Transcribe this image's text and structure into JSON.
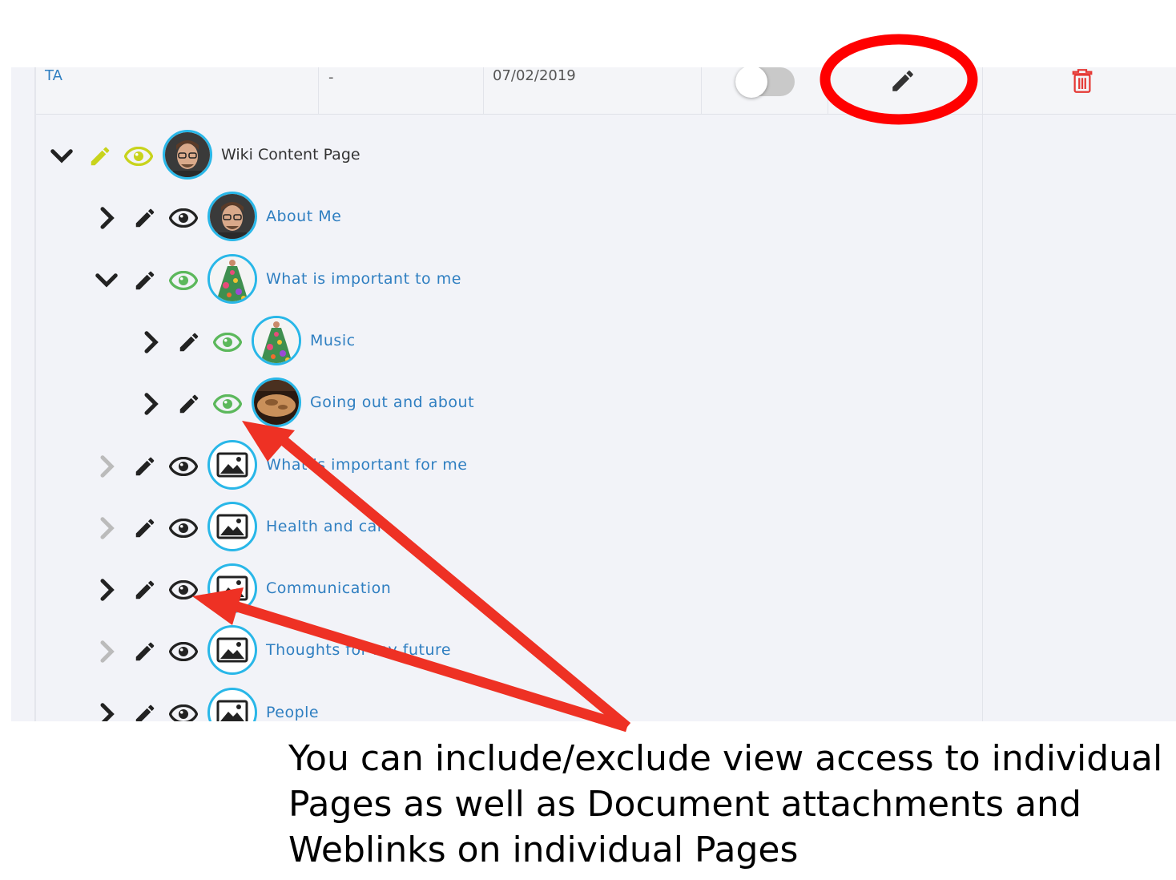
{
  "table_row": {
    "name": "TA",
    "dash": "-",
    "date": "07/02/2019",
    "toggle_state": "off"
  },
  "tree": {
    "root": {
      "label": "Wiki Content Page",
      "expanded": true,
      "edit_color": "#c8d31c",
      "view_color": "#c8d31c",
      "avatar": "man-with-glasses"
    },
    "items": [
      {
        "label": "About Me",
        "level": 1,
        "chevron": "right",
        "chevron_color": "#222222",
        "view_color": "#222222",
        "avatar": "man-with-glasses"
      },
      {
        "label": "What is important to me",
        "level": 1,
        "chevron": "down",
        "chevron_color": "#222222",
        "view_color": "#5cb85c",
        "avatar": "flower-dress"
      },
      {
        "label": "Music",
        "level": 2,
        "chevron": "right",
        "chevron_color": "#222222",
        "view_color": "#5cb85c",
        "avatar": "flower-dress"
      },
      {
        "label": "Going out and about",
        "level": 2,
        "chevron": "right",
        "chevron_color": "#222222",
        "view_color": "#5cb85c",
        "avatar": "bread"
      },
      {
        "label": "What is important for me",
        "level": 1,
        "chevron": "right",
        "chevron_color": "#bbbbbb",
        "view_color": "#222222",
        "avatar": "image-placeholder"
      },
      {
        "label": "Health and care",
        "level": 1,
        "chevron": "right",
        "chevron_color": "#bbbbbb",
        "view_color": "#222222",
        "avatar": "image-placeholder"
      },
      {
        "label": "Communication",
        "level": 1,
        "chevron": "right",
        "chevron_color": "#222222",
        "view_color": "#222222",
        "avatar": "image-placeholder"
      },
      {
        "label": "Thoughts for my future",
        "level": 1,
        "chevron": "right",
        "chevron_color": "#bbbbbb",
        "view_color": "#222222",
        "avatar": "image-placeholder"
      },
      {
        "label": "People",
        "level": 1,
        "chevron": "right",
        "chevron_color": "#222222",
        "view_color": "#222222",
        "avatar": "image-placeholder"
      }
    ]
  },
  "annotation": {
    "lines": [
      "You can include/exclude view access to individual",
      "Pages as well as Document attachments and",
      "Weblinks on individual Pages"
    ],
    "arrow_color": "#ee3124",
    "circle_color": "#ff0000"
  },
  "colors": {
    "link": "#2f7fc1",
    "trash": "#e53935",
    "avatar_ring": "#29b7e8"
  }
}
